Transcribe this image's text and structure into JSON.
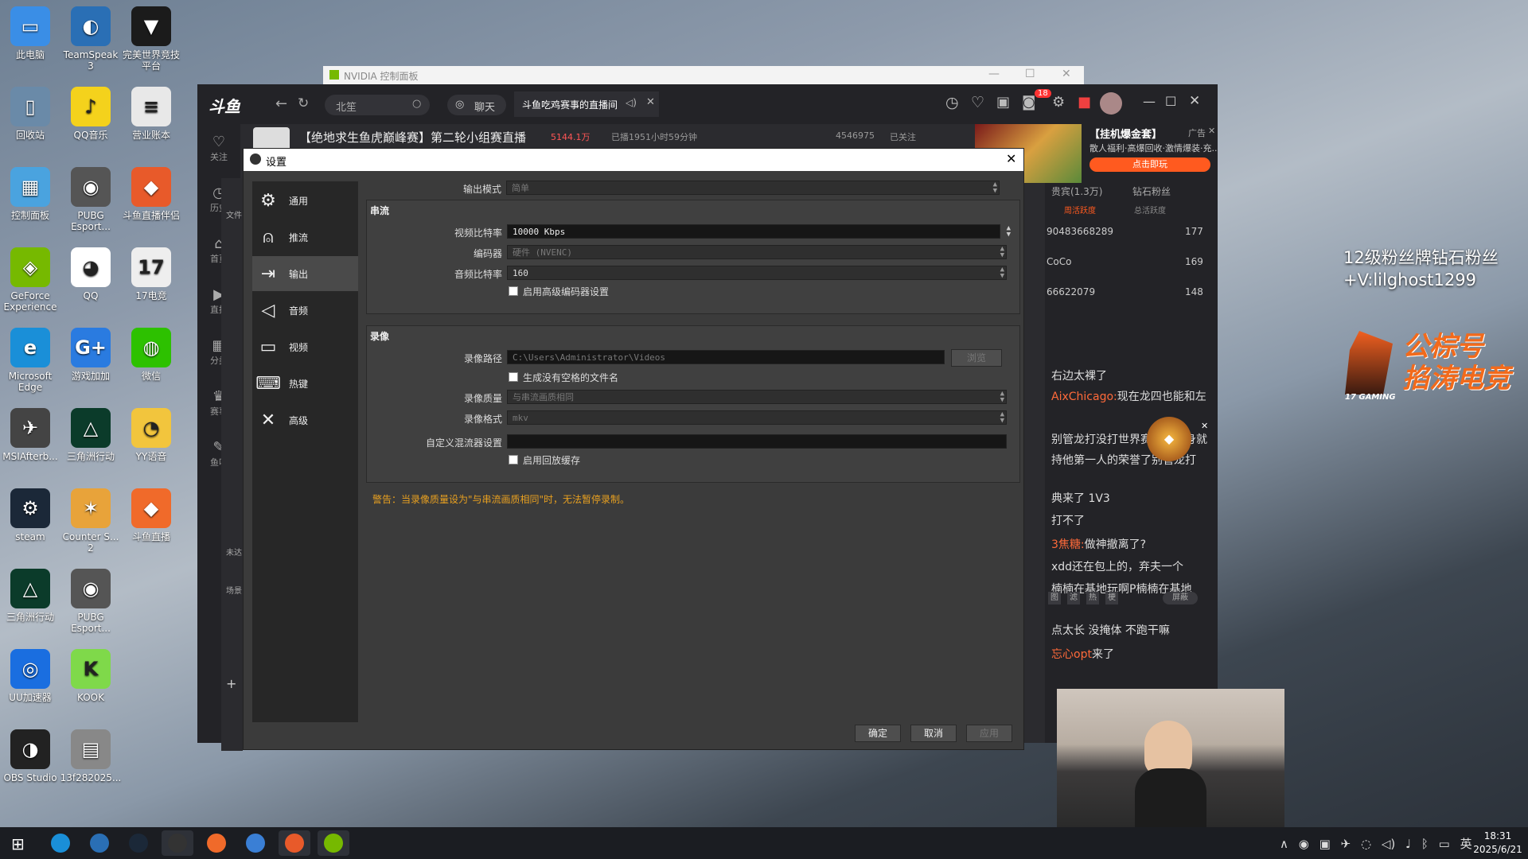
{
  "desktop_icons": [
    {
      "label": "此电脑",
      "color": "#3a8ee6",
      "glyph": "▭"
    },
    {
      "label": "TeamSpeak 3",
      "color": "#2a6fb5",
      "glyph": "◐"
    },
    {
      "label": "完美世界竞技平台",
      "color": "#1b1b1b",
      "glyph": "▼"
    },
    {
      "label": "回收站",
      "color": "#6a8aa8",
      "glyph": "▯"
    },
    {
      "label": "QQ音乐",
      "color": "#f4d21c",
      "glyph": "♪"
    },
    {
      "label": "营业账本",
      "color": "#e8e8e8",
      "glyph": "≡"
    },
    {
      "label": "控制面板",
      "color": "#4aa3df",
      "glyph": "▦"
    },
    {
      "label": "PUBG Esport...",
      "color": "#555",
      "glyph": "◉"
    },
    {
      "label": "斗鱼直播伴侣",
      "color": "#e85a2a",
      "glyph": "◆"
    },
    {
      "label": "GeForce Experience",
      "color": "#76b900",
      "glyph": "◈"
    },
    {
      "label": "QQ",
      "color": "#fff",
      "glyph": "◕"
    },
    {
      "label": "17电竞",
      "color": "#eee",
      "glyph": "17"
    },
    {
      "label": "Microsoft Edge",
      "color": "#1a8fd8",
      "glyph": "e"
    },
    {
      "label": "游戏加加",
      "color": "#2a7be0",
      "glyph": "G+"
    },
    {
      "label": "微信",
      "color": "#2dc100",
      "glyph": "◍"
    },
    {
      "label": "MSIAfterb...",
      "color": "#444",
      "glyph": "✈"
    },
    {
      "label": "三角洲行动",
      "color": "#0b3b2a",
      "glyph": "△"
    },
    {
      "label": "YY语音",
      "color": "#f2c53d",
      "glyph": "◔"
    },
    {
      "label": "steam",
      "color": "#1b2838",
      "glyph": "⚙"
    },
    {
      "label": "Counter S... 2",
      "color": "#e8a33a",
      "glyph": "✶"
    },
    {
      "label": "斗鱼直播",
      "color": "#f06a2a",
      "glyph": "◆"
    },
    {
      "label": "三角洲行动",
      "color": "#0b3b2a",
      "glyph": "△"
    },
    {
      "label": "PUBG Esport...",
      "color": "#555",
      "glyph": "◉"
    },
    {
      "label": "UU加速器",
      "color": "#1a6ee0",
      "glyph": "◎"
    },
    {
      "label": "KOOK",
      "color": "#7fd94a",
      "glyph": "K"
    },
    {
      "label": "OBS Studio",
      "color": "#222",
      "glyph": "◑"
    },
    {
      "label": "13f282025...",
      "color": "#888",
      "glyph": "▤"
    }
  ],
  "nvidia_window": {
    "title": "NVIDIA 控制面板"
  },
  "douyu": {
    "logo": "斗鱼",
    "search_placeholder": "北笙",
    "chat_tab": "聊天",
    "active_tab": "斗鱼吃鸡赛事的直播间",
    "badge_count": "18",
    "nav": [
      "关注",
      "历史",
      "首页",
      "直播",
      "分类",
      "赛事",
      "鱼吧"
    ],
    "stream_title": "【绝地求生鱼虎巅峰赛】第二轮小组赛直播",
    "hot": "5144.1万",
    "live_time": "已播1951小时59分钟",
    "followers": "4546975",
    "followed": "已关注",
    "ad_title": "【挂机爆金套】",
    "ad_tag": "广告",
    "ad_desc": "散人福利·高爆回收·激情爆装·充...",
    "ad_button": "点击即玩",
    "tabs_rank": [
      "贵宾(1.3万)",
      "钻石粉丝"
    ],
    "subtabs": [
      "周活跃度",
      "总活跃度"
    ],
    "ranks": [
      {
        "name": "90483668289",
        "score": "177"
      },
      {
        "name": "CoCo",
        "score": "169"
      },
      {
        "name": "66622079",
        "score": "148"
      }
    ],
    "chat": [
      {
        "user": "",
        "text": "右边太裸了"
      },
      {
        "user": "AixChicago:",
        "text": "现在龙四也能和左"
      },
      {
        "user": "",
        "text": "别管龙打没打世界赛。他本身就"
      },
      {
        "user": "",
        "text": "持他第一人的荣誉了别管龙打"
      },
      {
        "user": "",
        "text": "典来了 1V3"
      },
      {
        "user": "",
        "text": "打不了"
      },
      {
        "user": "3焦糖:",
        "text": "做神撤离了?"
      },
      {
        "user": "",
        "text": "xdd还在包上的，弃夫一个"
      },
      {
        "user": "",
        "text": "楠楠在基地玩啊P楠楠在基地"
      },
      {
        "user": "",
        "text": "点太长 没掩体 不跑干嘛"
      },
      {
        "user": "忘心opt",
        "text": "来了"
      }
    ],
    "chat_tools": [
      "图",
      "滤",
      "热",
      "梗"
    ],
    "block_label": "屏蔽",
    "side_text": [
      "文件",
      "未达",
      "场景"
    ]
  },
  "overlay": {
    "fan_text_1": "12级粉丝牌钻石粉丝",
    "fan_text_2": "+V:lilghost1299",
    "brand_line1": "公棕号",
    "brand_line2": "掐涛电竞",
    "brand_small": "17 GAMING"
  },
  "settings": {
    "title": "设置",
    "sidebar": [
      {
        "label": "通用",
        "icon": "gear-icon",
        "glyph": "⚙"
      },
      {
        "label": "推流",
        "icon": "antenna-icon",
        "glyph": "⍝"
      },
      {
        "label": "输出",
        "icon": "output-icon",
        "glyph": "⇥"
      },
      {
        "label": "音频",
        "icon": "speaker-icon",
        "glyph": "◁"
      },
      {
        "label": "视频",
        "icon": "monitor-icon",
        "glyph": "▭"
      },
      {
        "label": "热键",
        "icon": "keyboard-icon",
        "glyph": "⌨"
      },
      {
        "label": "高级",
        "icon": "tools-icon",
        "glyph": "✕"
      }
    ],
    "output_mode_label": "输出模式",
    "output_mode_value": "简单",
    "streaming": {
      "title": "串流",
      "video_bitrate_label": "视频比特率",
      "video_bitrate_value": "10000 Kbps",
      "encoder_label": "编码器",
      "encoder_value": "硬件 (NVENC)",
      "audio_bitrate_label": "音频比特率",
      "audio_bitrate_value": "160",
      "advanced_encoder_label": "启用高级编码器设置"
    },
    "recording": {
      "title": "录像",
      "path_label": "录像路径",
      "path_value": "C:\\Users\\Administrator\\Videos",
      "browse_label": "浏览",
      "no_space_label": "生成没有空格的文件名",
      "quality_label": "录像质量",
      "quality_value": "与串流画质相同",
      "format_label": "录像格式",
      "format_value": "mkv",
      "mux_label": "自定义混流器设置",
      "mux_value": "",
      "replay_label": "启用回放缓存"
    },
    "warning": "警告：当录像质量设为\"与串流画质相同\"时，无法暂停录制。",
    "ok": "确定",
    "cancel": "取消",
    "apply": "应用"
  },
  "tray": {
    "time": "18:31",
    "date": "2025/6/21",
    "ime": "英"
  }
}
